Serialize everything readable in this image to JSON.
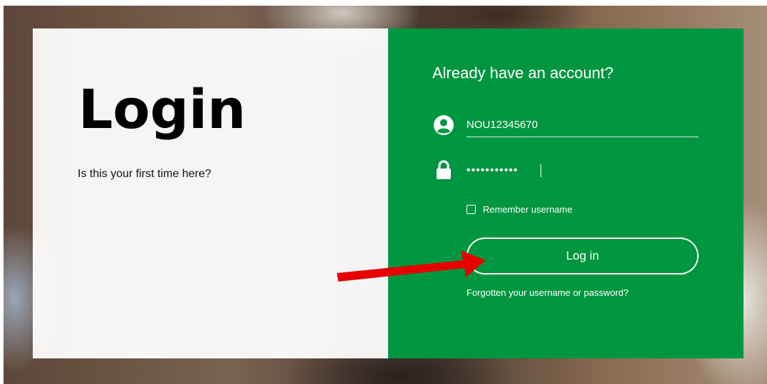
{
  "left_panel": {
    "title": "Login",
    "first_time_text": "Is this your first time here?"
  },
  "right_panel": {
    "heading": "Already have an account?",
    "username": {
      "value": "NOU12345670",
      "icon": "user-circle-icon"
    },
    "password": {
      "masked_value": "•••••••••••",
      "icon": "lock-icon"
    },
    "remember_label": "Remember username",
    "remember_checked": false,
    "login_button_label": "Log in",
    "forgot_link": "Forgotten your username or password?"
  },
  "colors": {
    "panel_green": "#009640",
    "annotation_arrow": "#e60000"
  }
}
